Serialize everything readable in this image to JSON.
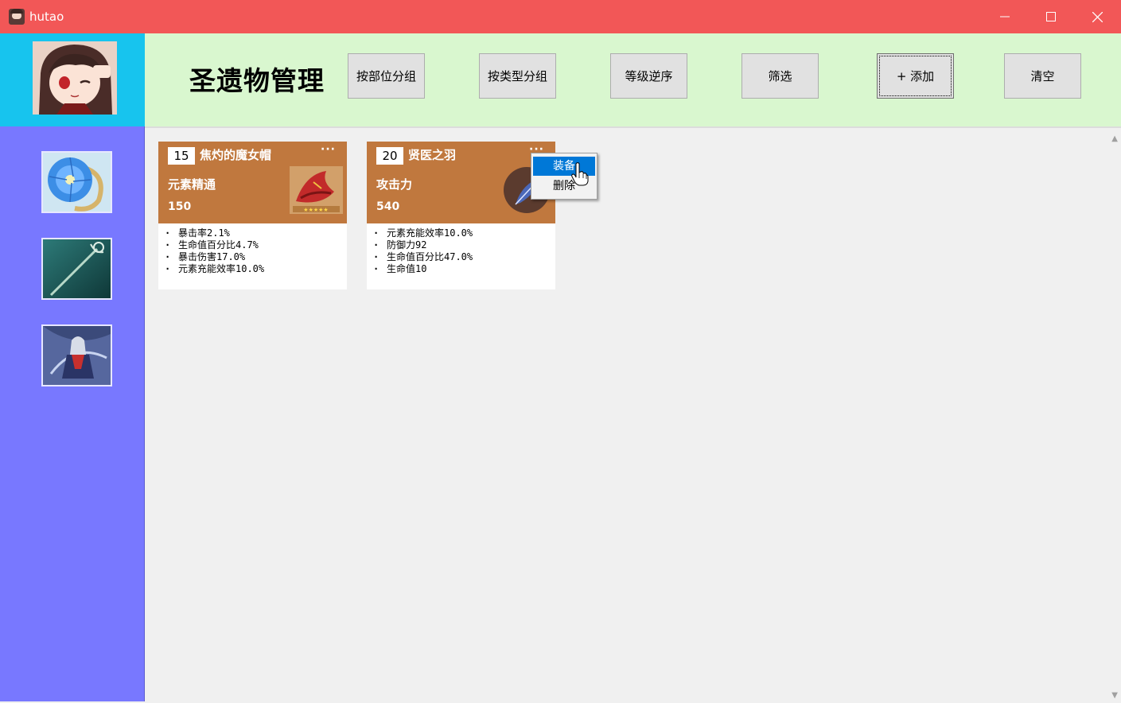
{
  "window": {
    "title": "hutao",
    "minimize_icon": "minimize-icon",
    "maximize_icon": "maximize-icon",
    "close_icon": "close-icon"
  },
  "header": {
    "title": "圣遗物管理",
    "buttons": [
      {
        "label": "按部位分组"
      },
      {
        "label": "按类型分组"
      },
      {
        "label": "等级逆序"
      },
      {
        "label": "筛选"
      },
      {
        "label": "+ 添加"
      },
      {
        "label": "清空"
      }
    ]
  },
  "sidebar": {
    "items": [
      {
        "icon": "flower-icon"
      },
      {
        "icon": "weapon-icon"
      },
      {
        "icon": "character-icon"
      }
    ]
  },
  "cards": [
    {
      "level": "15",
      "name": "焦灼的魔女帽",
      "more": "···",
      "main_stat": "元素精通",
      "main_value": "150",
      "substats": [
        "暴击率2.1%",
        "生命值百分比4.7%",
        "暴击伤害17.0%",
        "元素充能效率10.0%"
      ]
    },
    {
      "level": "20",
      "name": "贤医之羽",
      "more": "···",
      "main_stat": "攻击力",
      "main_value": "540",
      "substats": [
        "元素充能效率10.0%",
        "防御力92",
        "生命值百分比47.0%",
        "生命值10"
      ]
    }
  ],
  "context_menu": {
    "items": [
      "装备",
      "删除"
    ],
    "active_index": 0
  },
  "colors": {
    "titlebar": "#f25757",
    "header": "#d9f7cf",
    "sidebar": "#7878ff",
    "avatar_panel": "#17c4ee",
    "card_header": "#c0783e",
    "menu_active": "#0078d7"
  }
}
